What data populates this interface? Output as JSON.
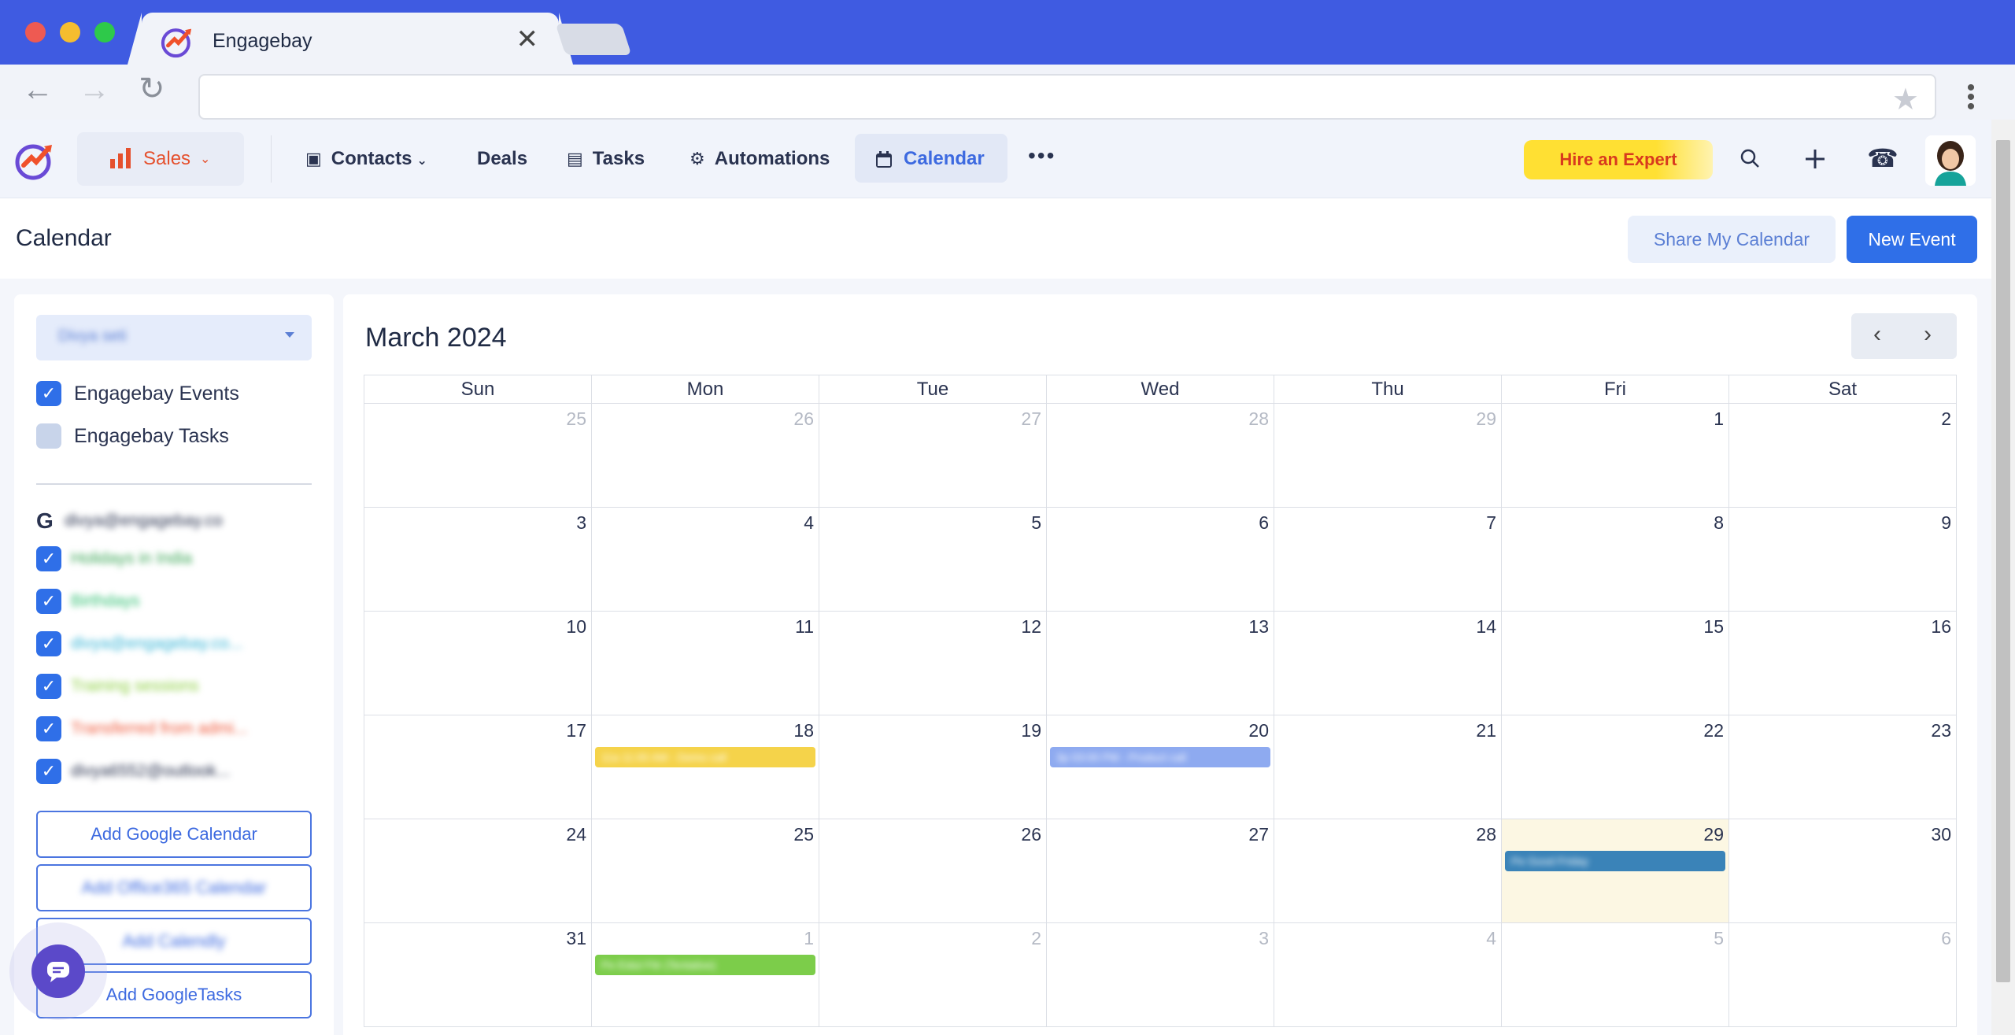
{
  "browser": {
    "tab_title": "Engagebay",
    "tab_close": "✕",
    "back": "←",
    "forward": "→",
    "reload": "↻",
    "star": "★"
  },
  "topnav": {
    "sales_label": "Sales",
    "items": [
      "Contacts",
      "Deals",
      "Tasks",
      "Automations"
    ],
    "calendar_label": "Calendar",
    "more": "•••",
    "hire_label": "Hire an Expert"
  },
  "header": {
    "title": "Calendar",
    "share_label": "Share My Calendar",
    "new_event_label": "New Event"
  },
  "sidebar": {
    "owner_select": "Divya seti",
    "calendars": [
      {
        "label": "Engagebay Events",
        "checked": true
      },
      {
        "label": "Engagebay Tasks",
        "checked": false
      }
    ],
    "google_account": "divya@engagebay.co",
    "google_calendars": [
      {
        "label": "Holidays in India",
        "color": "#3aa655"
      },
      {
        "label": "Birthdays",
        "color": "#2fbf71"
      },
      {
        "label": "divya@engagebay.co...",
        "color": "#37b4d6"
      },
      {
        "label": "Training sessions",
        "color": "#8ccf3f"
      },
      {
        "label": "Transferred from admi...",
        "color": "#f05a3c"
      },
      {
        "label": "divya6552@outlook...",
        "color": "#2a3350"
      }
    ],
    "buttons": [
      "Add Google Calendar",
      "Add Office365 Calendar",
      "Add Calendly",
      "Add GoogleTasks"
    ]
  },
  "calendar": {
    "month_label": "March 2024",
    "prev": "‹",
    "next": "›",
    "days_of_week": [
      "Sun",
      "Mon",
      "Tue",
      "Wed",
      "Thu",
      "Fri",
      "Sat"
    ],
    "weeks": [
      [
        {
          "d": "25",
          "o": true
        },
        {
          "d": "26",
          "o": true
        },
        {
          "d": "27",
          "o": true
        },
        {
          "d": "28",
          "o": true
        },
        {
          "d": "29",
          "o": true
        },
        {
          "d": "1"
        },
        {
          "d": "2"
        }
      ],
      [
        {
          "d": "3"
        },
        {
          "d": "4"
        },
        {
          "d": "5"
        },
        {
          "d": "6"
        },
        {
          "d": "7"
        },
        {
          "d": "8"
        },
        {
          "d": "9"
        }
      ],
      [
        {
          "d": "10"
        },
        {
          "d": "11"
        },
        {
          "d": "12"
        },
        {
          "d": "13"
        },
        {
          "d": "14"
        },
        {
          "d": "15"
        },
        {
          "d": "16"
        }
      ],
      [
        {
          "d": "17"
        },
        {
          "d": "18"
        },
        {
          "d": "19"
        },
        {
          "d": "20"
        },
        {
          "d": "21"
        },
        {
          "d": "22"
        },
        {
          "d": "23"
        }
      ],
      [
        {
          "d": "24"
        },
        {
          "d": "25"
        },
        {
          "d": "26"
        },
        {
          "d": "27"
        },
        {
          "d": "28"
        },
        {
          "d": "29",
          "today": true
        },
        {
          "d": "30"
        }
      ],
      [
        {
          "d": "31"
        },
        {
          "d": "1",
          "o": true
        },
        {
          "d": "2",
          "o": true
        },
        {
          "d": "3",
          "o": true
        },
        {
          "d": "4",
          "o": true
        },
        {
          "d": "5",
          "o": true
        },
        {
          "d": "6",
          "o": true
        }
      ]
    ],
    "events": [
      {
        "week": 3,
        "day": 1,
        "text": "11a  11:00 AM - Demo call",
        "color": "#f5d34a"
      },
      {
        "week": 3,
        "day": 3,
        "text": "3p  03:00 PM - Product call",
        "color": "#8eaaf0"
      },
      {
        "week": 4,
        "day": 5,
        "text": "Pe  Good Friday",
        "color": "#3a83b8"
      },
      {
        "week": 5,
        "day": 1,
        "text": "Pe  Eidul Fitr (Tentative)",
        "color": "#7ccd4a"
      }
    ]
  }
}
